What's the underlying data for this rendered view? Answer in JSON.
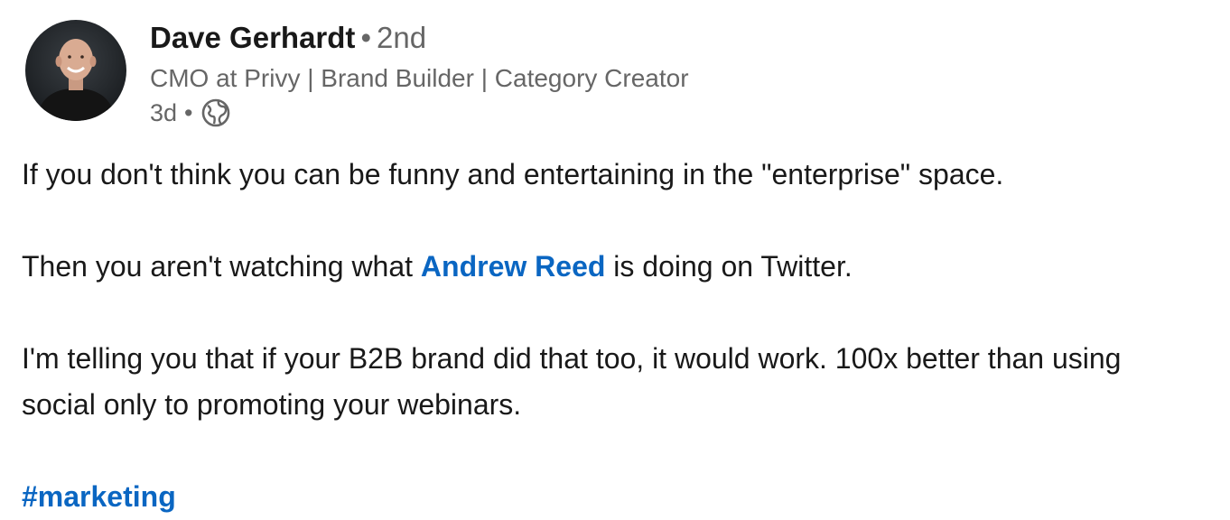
{
  "author": {
    "name": "Dave Gerhardt",
    "bullet": "•",
    "degree": "2nd",
    "headline": "CMO at Privy | Brand Builder | Category Creator",
    "time": "3d",
    "visibility_icon": "globe-icon"
  },
  "post": {
    "para1": "If you don't think you can be funny and entertaining in the \"enterprise\" space.",
    "para2_before": "Then you aren't watching what ",
    "para2_mention": "Andrew Reed",
    "para2_after": " is doing on Twitter.",
    "para3": "I'm telling you that if your B2B brand did that too, it would work. 100x better than using social only to promoting your webinars.",
    "hashtag": "#marketing"
  },
  "colors": {
    "link": "#0a66c2",
    "text": "#191919",
    "muted": "#666666"
  }
}
